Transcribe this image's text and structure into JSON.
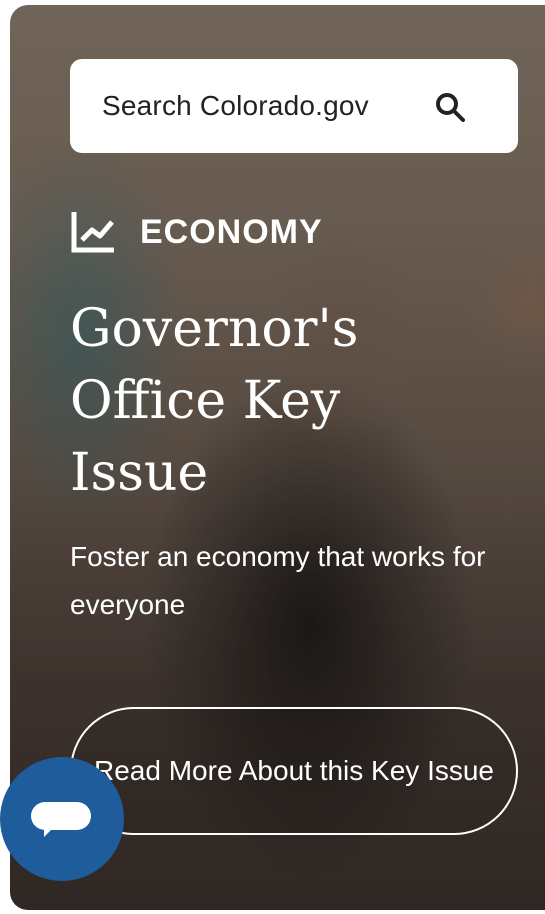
{
  "search": {
    "placeholder": "Search Colorado.gov",
    "icon": "search-icon"
  },
  "category": {
    "icon": "line-chart-icon",
    "label": "ECONOMY"
  },
  "headline": "Governor's Office Key Issue",
  "description": "Foster an economy that works for everyone",
  "cta": {
    "label": "Read More About this Key Issue"
  },
  "chat": {
    "icon": "chat-bubble-icon",
    "color": "#1f5c9c"
  }
}
